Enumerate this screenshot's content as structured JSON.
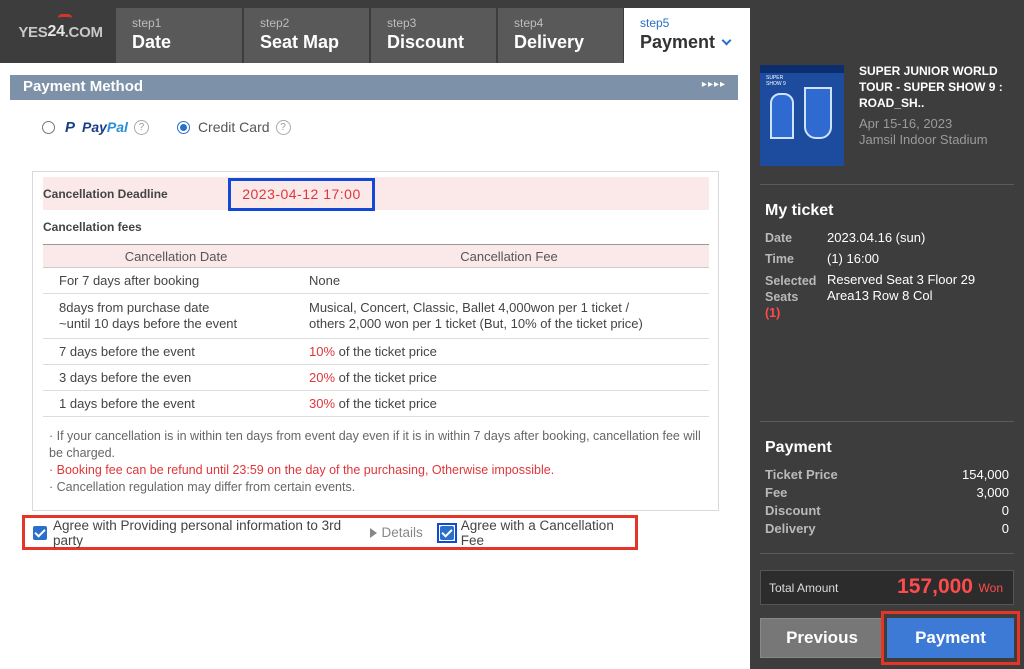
{
  "logo": {
    "text_pre": "YES",
    "text_num": "24",
    "text_post": ".COM"
  },
  "steps": [
    {
      "num": "step1",
      "label": "Date"
    },
    {
      "num": "step2",
      "label": "Seat Map"
    },
    {
      "num": "step3",
      "label": "Discount"
    },
    {
      "num": "step4",
      "label": "Delivery"
    },
    {
      "num": "step5",
      "label": "Payment",
      "active": true
    }
  ],
  "payment_method": {
    "title": "Payment Method",
    "arrows": "▸▸▸▸",
    "options": [
      {
        "label_a": "Pay",
        "label_b": "Pal",
        "selected": false
      },
      {
        "label": "Credit Card",
        "selected": true
      }
    ],
    "help_glyph": "?"
  },
  "cancellation": {
    "deadline_label": "Cancellation Deadline",
    "deadline_value": "2023-04-12 17:00",
    "fees_label": "Cancellation fees",
    "columns": [
      "Cancellation Date",
      "Cancellation Fee"
    ],
    "rows": [
      {
        "date": "For 7 days after booking",
        "fee": "None"
      },
      {
        "date_1": "8days from purchase date",
        "date_2": "~until 10 days before the event",
        "fee_1": "Musical, Concert, Classic, Ballet 4,000won per 1 ticket /",
        "fee_2": "others 2,000 won per 1 ticket (But, 10% of the ticket price)"
      },
      {
        "date": "7 days before the event",
        "pct": "10%",
        "fee_rest": " of the ticket price"
      },
      {
        "date": "3 days before the even",
        "pct": "20%",
        "fee_rest": " of the ticket price"
      },
      {
        "date": "1 days before the event",
        "pct": "30%",
        "fee_rest": " of the ticket price"
      }
    ],
    "notes": [
      "If your cancellation is in within ten days from event day even if it is in within 7 days after booking, cancellation fee will be charged.",
      "Booking fee can be refund until 23:59 on the day of the purchasing, Otherwise impossible.",
      "Cancellation regulation may differ from certain events."
    ]
  },
  "agreements": {
    "personal_info": "Agree with Providing personal information to 3rd party",
    "details": "Details",
    "cancellation_fee": "Agree with a Cancellation Fee",
    "personal_info_checked": true,
    "cancellation_fee_checked": true
  },
  "side": {
    "poster_text": "SUPER SHOW 9",
    "show_title": "SUPER JUNIOR WORLD TOUR - SUPER SHOW 9 : ROAD_SH..",
    "show_dates": "Apr 15-16, 2023",
    "venue": "Jamsil Indoor Stadium",
    "my_ticket_title": "My ticket",
    "date_label": "Date",
    "date_value": "2023.04.16 (sun)",
    "time_label": "Time",
    "time_value": "(1) 16:00",
    "seats_label_1": "Selected",
    "seats_label_2": "Seats",
    "seats_count": "(1)",
    "seats_value_1": "Reserved Seat 3 Floor 29",
    "seats_value_2": "Area13 Row 8 Col",
    "payment_title": "Payment",
    "payment_rows": [
      {
        "label": "Ticket Price",
        "value": "154,000"
      },
      {
        "label": "Fee",
        "value": "3,000"
      },
      {
        "label": "Discount",
        "value": "0"
      },
      {
        "label": "Delivery",
        "value": "0"
      }
    ],
    "total_label": "Total Amount",
    "total_value": "157,000",
    "total_unit": "Won",
    "previous_label": "Previous",
    "payment_button": "Payment"
  },
  "colors": {
    "accent": "#2a6fc9",
    "highlight_red": "#e53528",
    "price_red": "#ff4b4b",
    "deadline_border": "#1148d6"
  }
}
